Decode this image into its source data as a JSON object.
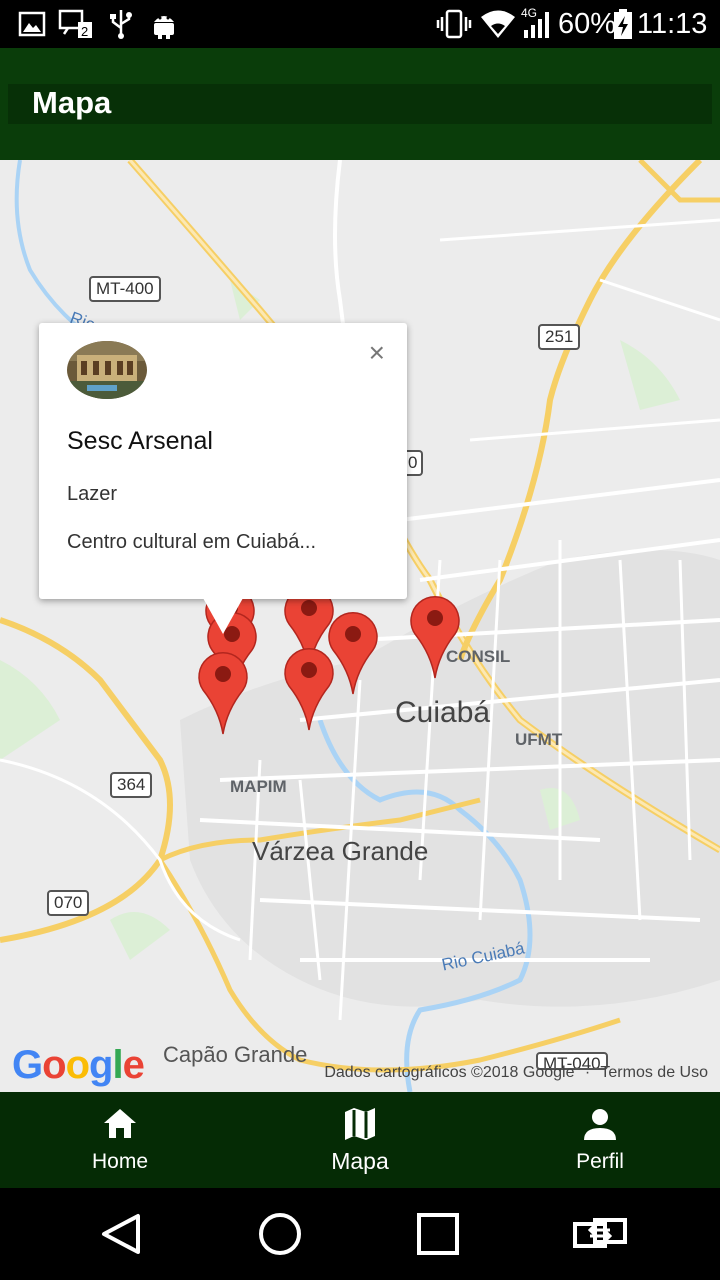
{
  "status_bar": {
    "battery_percent": "60%",
    "time": "11:13",
    "network_type": "4G",
    "icons": [
      "image-icon",
      "sim-icon",
      "usb-icon",
      "android-icon",
      "vibrate-icon",
      "wifi-icon",
      "signal-icon",
      "battery-charging-icon"
    ]
  },
  "app_bar": {
    "title": "Mapa"
  },
  "map": {
    "labels": {
      "city_main": "Cuiabá",
      "city_secondary": "Várzea Grande",
      "district_consil": "CONSIL",
      "district_ufmt": "UFMT",
      "district_mapim": "MAPIM",
      "capao_grande": "Capão Grande",
      "river_bottom": "Rio Cuiabá",
      "river_top_fragment": "Rio"
    },
    "road_shields": {
      "mt400": "MT-400",
      "r251": "251",
      "r364": "364",
      "r070": "070",
      "mt040": "MT-040",
      "partial_0": "0"
    },
    "attribution": "Dados cartográficos ©2018 Google",
    "terms": "Termos de Uso",
    "logo_text": "Google",
    "marker_color": "#ea4335"
  },
  "info_window": {
    "title": "Sesc Arsenal",
    "category": "Lazer",
    "description": "Centro cultural em Cuiabá...",
    "close_label": "×"
  },
  "bottom_nav": {
    "items": [
      {
        "label": "Home",
        "icon": "home-icon"
      },
      {
        "label": "Mapa",
        "icon": "map-icon"
      },
      {
        "label": "Perfil",
        "icon": "person-icon"
      }
    ],
    "active": "Mapa"
  },
  "system_nav": {
    "buttons": [
      "back-icon",
      "home-circle-icon",
      "recents-icon",
      "switch-app-icon"
    ]
  },
  "colors": {
    "app_bar": "#0a3d0a",
    "bottom_nav": "#052b05",
    "map_background": "#ececec"
  }
}
